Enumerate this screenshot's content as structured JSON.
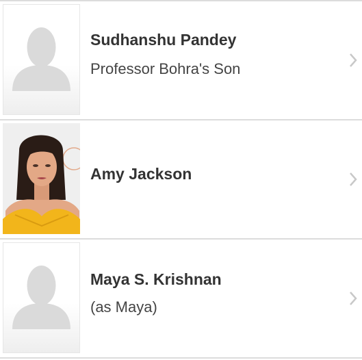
{
  "cast": [
    {
      "name": "Sudhanshu Pandey",
      "role": "Professor Bohra's Son",
      "photo": "placeholder-avatar"
    },
    {
      "name": "Amy Jackson",
      "role": "",
      "photo": "actor-headshot"
    },
    {
      "name": "Maya S. Krishnan",
      "role": "(as Maya)",
      "photo": "placeholder-avatar"
    }
  ],
  "icons": {
    "chevron": "chevron-right-icon",
    "placeholder": "person-silhouette-icon"
  },
  "colors": {
    "divider": "#dcdcdc",
    "silhouette": "#dadada",
    "chevron": "#c8c8c8",
    "name_text": "#333333",
    "role_text": "#444444",
    "photo_dress": "#f2b51b"
  }
}
